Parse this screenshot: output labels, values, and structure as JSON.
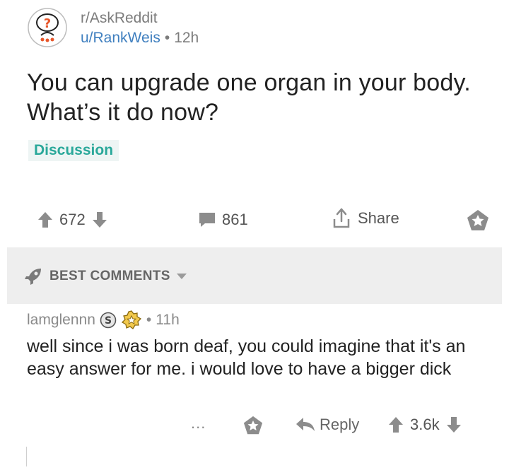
{
  "post": {
    "subreddit": "r/AskReddit",
    "author": "u/RankWeis",
    "separator": "•",
    "age": "12h",
    "title": "You can upgrade one organ in your body. What’s it do now?",
    "flair": "Discussion",
    "upvotes": "672",
    "comment_count": "861",
    "share_label": "Share"
  },
  "comments_section": {
    "sort_label": "BEST COMMENTS"
  },
  "top_comment": {
    "author": "lamglennn",
    "separator": "•",
    "age": "11h",
    "body": "well since i was born deaf, you could imagine that it's an easy answer for me. i would love to have a bigger dick",
    "more_label": "...",
    "reply_label": "Reply",
    "score": "3.6k"
  },
  "colors": {
    "author_link": "#3f7fbf",
    "flair_text": "#2aa89a",
    "flair_bg": "#eef5f4",
    "icon_gray": "#8c8c8c"
  }
}
